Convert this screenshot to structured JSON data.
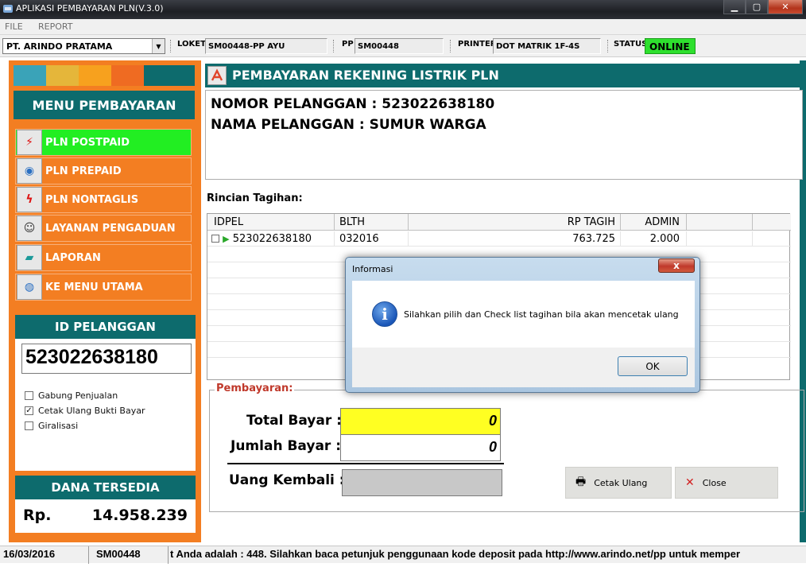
{
  "window": {
    "title": "APLIKASI PEMBAYARAN PLN(V.3.0)"
  },
  "menubar": {
    "file": "FILE",
    "report": "REPORT"
  },
  "infobar": {
    "company": "PT. ARINDO PRATAMA",
    "loket_label": "LOKET",
    "loket_value": "SM00448-PP AYU",
    "pp_label": "PP",
    "pp_value": "SM00448",
    "printer_label": "PRINTER",
    "printer_value": "DOT MATRIK 1F-4S",
    "status_label": "STATUS",
    "status_value": "ONLINE"
  },
  "colors": {
    "teal": "#0d6b6d",
    "orange": "#f37e22",
    "active_green": "#22ee22",
    "strip": [
      "#3aa3b8",
      "#e5b63a",
      "#f7a11e",
      "#ef6b22",
      "#0d6b6d"
    ]
  },
  "menu": {
    "title": "MENU PEMBAYARAN",
    "items": [
      {
        "label": "PLN POSTPAID",
        "icon": "lightning-icon"
      },
      {
        "label": "PLN PREPAID",
        "icon": "globe-icon"
      },
      {
        "label": "PLN NONTAGLIS",
        "icon": "bolt-document-icon"
      },
      {
        "label": "LAYANAN PENGADUAN",
        "icon": "people-icon"
      },
      {
        "label": "LAPORAN",
        "icon": "report-book-icon"
      },
      {
        "label": "KE MENU UTAMA",
        "icon": "home-globe-icon"
      }
    ]
  },
  "id_pelanggan": {
    "title": "ID PELANGGAN",
    "value": "523022638180",
    "options": [
      {
        "label": "Gabung Penjualan",
        "checked": false
      },
      {
        "label": "Cetak Ulang Bukti Bayar",
        "checked": true
      },
      {
        "label": "Giralisasi",
        "checked": false
      }
    ]
  },
  "dana": {
    "title": "DANA TERSEDIA",
    "currency": "Rp.",
    "amount": "14.958.239"
  },
  "main": {
    "header_title": "PEMBAYARAN REKENING LISTRIK PLN",
    "nomor_line": "NOMOR PELANGGAN : 523022638180",
    "nama_line": "NAMA PELANGGAN : SUMUR WARGA",
    "rincian_label": "Rincian Tagihan:",
    "table": {
      "headers": [
        "IDPEL",
        "BLTH",
        "RP TAGIH",
        "ADMIN"
      ],
      "rows": [
        {
          "idpel": "523022638180",
          "blth": "032016",
          "rp_tagih": "763.725",
          "admin": "2.000"
        }
      ]
    }
  },
  "pembayaran": {
    "legend": "Pembayaran:",
    "total_label": "Total Bayar :",
    "total_value": "0",
    "jumlah_label": "Jumlah Bayar :",
    "jumlah_value": "0",
    "kembali_label": "Uang Kembali :",
    "kembali_value": "",
    "cetak_label": "Cetak Ulang",
    "close_label": "Close"
  },
  "statusbar": {
    "date": "16/03/2016",
    "user": "SM00448",
    "message": "t Anda adalah : 448. Silahkan baca petunjuk penggunaan kode deposit pada http://www.arindo.net/pp untuk memper"
  },
  "dialog": {
    "title": "Informasi",
    "close": "x",
    "message": "Silahkan pilih dan Check list tagihan bila akan mencetak ulang",
    "ok": "OK"
  }
}
